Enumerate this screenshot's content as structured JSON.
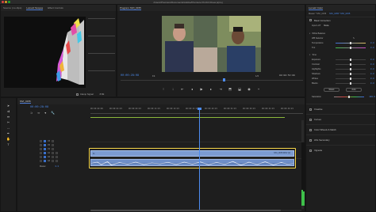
{
  "window": {
    "title": "/Users/Premiere/Documents/Adobe/Premiere Pro/10.0/new.prproj"
  },
  "source_panel": {
    "tabs": [
      "Source: (no clips)",
      "Lumetri Scopes",
      "Effect Controls"
    ],
    "active_tab": 1,
    "clamp_label": "Clamp Signal",
    "scope_options": [
      "8 Bit"
    ]
  },
  "program_panel": {
    "tab": "Program: MVI_0155",
    "timecode": "00:00:28:08",
    "fit": "Fit",
    "zoom": "1/2",
    "duration": "00:00:53:09"
  },
  "lumetri": {
    "tabs": [
      "Lumetri Color"
    ],
    "target": "Master * MVI_0155",
    "target_clip": "MVI_0155 * MVI_0155",
    "basic_correction": "Basic Correction",
    "input_lut_label": "Input LUT",
    "input_lut_value": "None",
    "white_balance": "White Balance",
    "wb_selector": "WB Selector",
    "temperature_label": "Temperature",
    "temperature_value": "0.0",
    "tint_label": "Tint",
    "tint_value": "0.0",
    "tone": "Tone",
    "tone_rows": [
      {
        "label": "Exposure",
        "value": "0.0"
      },
      {
        "label": "Contrast",
        "value": "0.0"
      },
      {
        "label": "Highlights",
        "value": "0.0"
      },
      {
        "label": "Shadows",
        "value": "0.0"
      },
      {
        "label": "Whites",
        "value": "0.0"
      },
      {
        "label": "Blacks",
        "value": "0.0"
      }
    ],
    "reset_button": "Reset",
    "auto_button": "Auto",
    "saturation_label": "Saturation",
    "saturation_value": "100.0",
    "sections": [
      "Creative",
      "Curves",
      "Color Wheels & Match",
      "HSL Secondary",
      "Vignette"
    ]
  },
  "timeline": {
    "tab": "MVI_0155",
    "timecode": "00:00:28:08",
    "ruler_ticks": [
      "00:00:00:00",
      "00:00:04:23",
      "00:00:09:23",
      "00:00:14:23",
      "00:00:19:23",
      "00:00:24:23",
      "00:00:29:23",
      "00:00:34:23",
      "00:00:39:23",
      "00:00:44:23",
      "00:00:49:23",
      "00:00:54:22"
    ],
    "video_tracks": [
      "V3",
      "V2",
      "V1"
    ],
    "audio_tracks": [
      "A1",
      "A2",
      "A3"
    ],
    "master_label": "Master",
    "master_value": "0.0",
    "clip_label": "MVI_0155.MOV [V]",
    "playhead_fraction": 0.51,
    "clip_start_fraction": 0.0,
    "clip_end_fraction": 0.96
  },
  "colors": {
    "accent": "#4d8cf0",
    "highlight": "#f5d64a",
    "clip_video": "#7c9bd1",
    "clip_audio": "#6f8fc8"
  }
}
